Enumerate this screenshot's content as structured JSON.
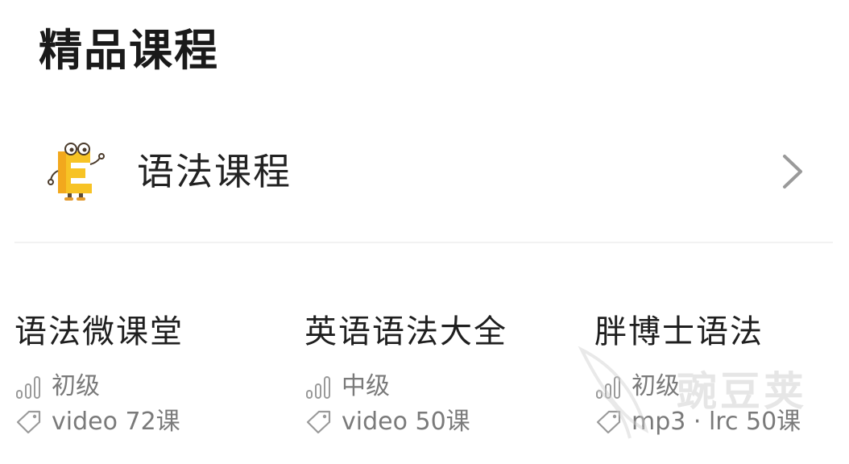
{
  "section": {
    "title": "精品课程"
  },
  "category": {
    "label": "语法课程",
    "icon": "letter-e-mascot-icon",
    "accent_color": "#F7C325",
    "chevron_icon": "chevron-right-icon"
  },
  "courses": [
    {
      "title": "语法微课堂",
      "level": "初级",
      "count": "video 72课",
      "level_icon": "signal-bars-icon",
      "count_icon": "tag-icon"
    },
    {
      "title": "英语语法大全",
      "level": "中级",
      "count": "video 50课",
      "level_icon": "signal-bars-icon",
      "count_icon": "tag-icon"
    },
    {
      "title": "胖博士语法",
      "level": "初级",
      "count": "mp3 · lrc 50课",
      "level_icon": "signal-bars-icon",
      "count_icon": "tag-icon"
    }
  ],
  "watermark": {
    "text": "豌豆荚"
  },
  "colors": {
    "title": "#1a1a1a",
    "meta": "#7a7a7a",
    "divider": "#f2f2f2"
  }
}
